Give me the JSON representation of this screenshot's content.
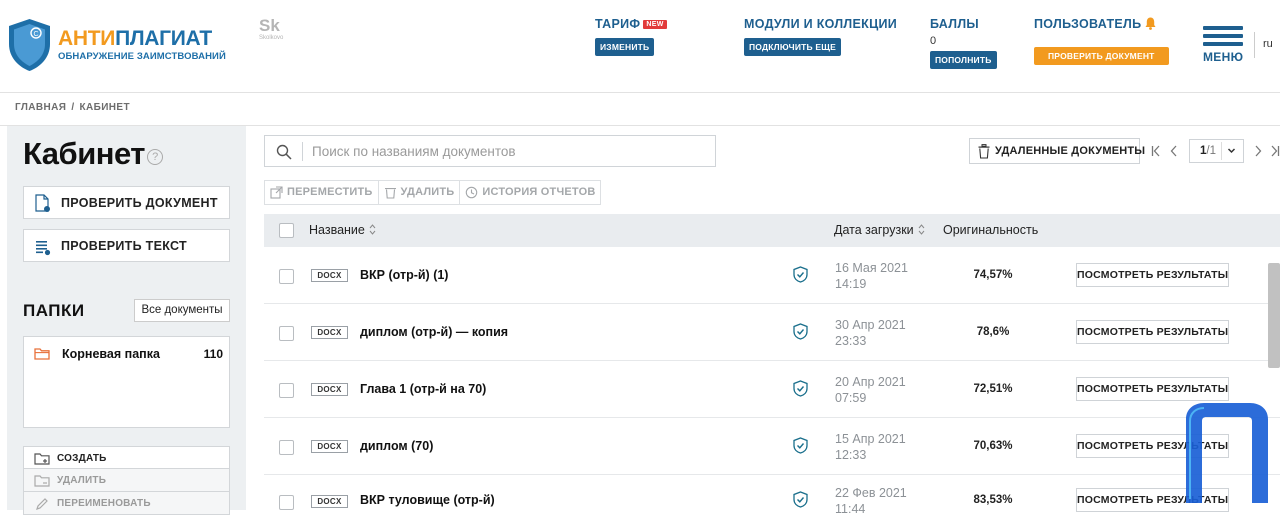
{
  "header": {
    "logo": {
      "word_part1": "АНТИ",
      "word_part2": "ПЛАГИАТ",
      "subtitle": "ОБНАРУЖЕНИЕ ЗАИМСТВОВАНИЙ"
    },
    "partner": {
      "mark": "Sk",
      "text": "Skolkovo"
    },
    "tariff": {
      "title": "ТАРИФ",
      "badge": "NEW",
      "button": "ИЗМЕНИТЬ"
    },
    "modules": {
      "title": "МОДУЛИ И КОЛЛЕКЦИИ",
      "button": "ПОДКЛЮЧИТЬ ЕЩЕ"
    },
    "points": {
      "title": "БАЛЛЫ",
      "value": "0",
      "button": "ПОПОЛНИТЬ"
    },
    "user": {
      "title": "ПОЛЬЗОВАТЕЛЬ",
      "button": "ПРОВЕРИТЬ ДОКУМЕНТ",
      "bell_icon": "bell-icon"
    },
    "menu_label": "МЕНЮ",
    "lang": "ru"
  },
  "breadcrumbs": [
    "ГЛАВНАЯ",
    "/",
    "КАБИНЕТ"
  ],
  "sidebar": {
    "title": "Кабинет",
    "help": "?",
    "check_document": "ПРОВЕРИТЬ ДОКУМЕНТ",
    "check_text": "ПРОВЕРИТЬ ТЕКСТ",
    "folders_title": "ПАПКИ",
    "all_documents": "Все документы",
    "root_folder": {
      "name": "Корневая папка",
      "count": "110"
    },
    "actions": {
      "create": "СОЗДАТЬ",
      "delete": "УДАЛИТЬ",
      "rename": "ПЕРЕИМЕНОВАТЬ"
    }
  },
  "search": {
    "placeholder": "Поиск по названиям документов",
    "value": ""
  },
  "deleted_documents": "УДАЛЕННЫЕ ДОКУМЕНТЫ",
  "pagination": {
    "current": "1",
    "total": "/1"
  },
  "toolbar": {
    "move": "ПЕРЕМЕСТИТЬ",
    "delete": "УДАЛИТЬ",
    "history": "ИСТОРИЯ ОТЧЕТОВ"
  },
  "table": {
    "columns": {
      "name": "Название",
      "date": "Дата загрузки",
      "originality": "Оригинальность"
    },
    "view_button": "ПОСМОТРЕТЬ РЕЗУЛЬТАТЫ",
    "rows": [
      {
        "type": "DOCX",
        "name": "ВКР (отр-й) (1)",
        "date": "16 Мая 2021",
        "time": "14:19",
        "originality": "74,57%"
      },
      {
        "type": "DOCX",
        "name": "диплом (отр-й) — копия",
        "date": "30 Апр 2021",
        "time": "23:33",
        "originality": "78,6%"
      },
      {
        "type": "DOCX",
        "name": "Глава 1 (отр-й на 70)",
        "date": "20 Апр 2021",
        "time": "07:59",
        "originality": "72,51%"
      },
      {
        "type": "DOCX",
        "name": "диплом (70)",
        "date": "15 Апр 2021",
        "time": "12:33",
        "originality": "70,63%"
      },
      {
        "type": "DOCX",
        "name": "ВКР туловище (отр-й)",
        "date": "22 Фев 2021",
        "time": "11:44",
        "originality": "83,53%"
      }
    ]
  },
  "colors": {
    "brand_blue": "#1e5f8f",
    "brand_orange": "#f29a1f",
    "badge_red": "#e23b3b",
    "watermark_blue": "#1a5fd6"
  }
}
